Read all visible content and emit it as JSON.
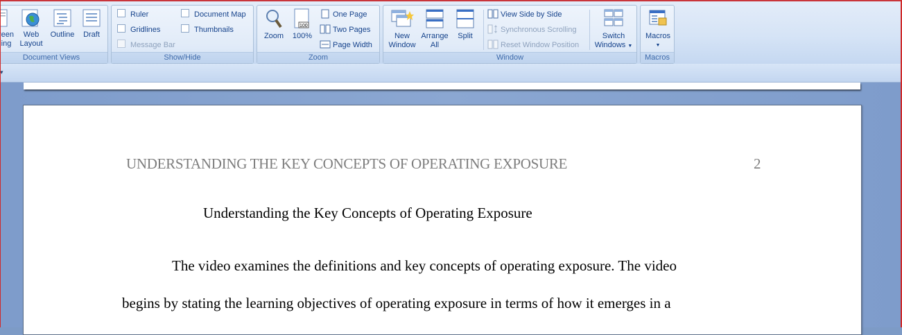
{
  "groups": {
    "document_views": "Document Views",
    "show_hide": "Show/Hide",
    "zoom": "Zoom",
    "window": "Window",
    "macros": "Macros"
  },
  "views": {
    "full_screen_top": "reen",
    "full_screen_bottom": "ing",
    "web_layout_top": "Web",
    "web_layout_bottom": "Layout",
    "outline": "Outline",
    "draft": "Draft"
  },
  "showhide": {
    "ruler": "Ruler",
    "gridlines": "Gridlines",
    "message_bar": "Message Bar",
    "document_map": "Document Map",
    "thumbnails": "Thumbnails"
  },
  "zoom": {
    "zoom": "Zoom",
    "hundred": "100%",
    "one_page": "One Page",
    "two_pages": "Two Pages",
    "page_width": "Page Width"
  },
  "window": {
    "new_window_top": "New",
    "new_window_bottom": "Window",
    "arrange_all_top": "Arrange",
    "arrange_all_bottom": "All",
    "split": "Split",
    "view_side_by_side": "View Side by Side",
    "synchronous_scrolling": "Synchronous Scrolling",
    "reset_window_position": "Reset Window Position",
    "switch_windows_top": "Switch",
    "switch_windows_bottom": "Windows"
  },
  "macros": {
    "label": "Macros"
  },
  "document": {
    "header": "UNDERSTANDING THE KEY CONCEPTS OF OPERATING EXPOSURE",
    "page_number": "2",
    "title": "Understanding the Key Concepts of Operating Exposure",
    "line1": "The video examines the definitions and key concepts of operating exposure. The video",
    "line2": "begins by stating the learning objectives of operating exposure in terms of how it emerges in a"
  },
  "colors": {
    "ribbon_text": "#15428b",
    "doc_background": "#7e9ccb",
    "accent_red": "#d02a2a"
  }
}
